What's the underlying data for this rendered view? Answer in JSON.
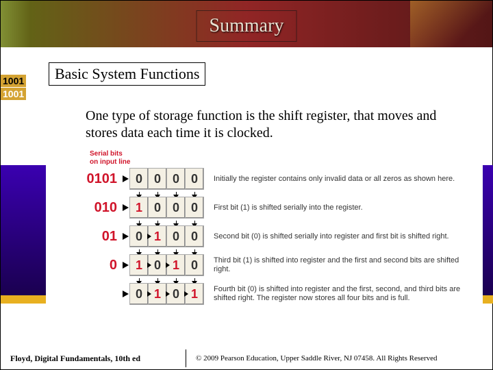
{
  "title": "Summary",
  "subtitle": "Basic System Functions",
  "body": "One type of storage function is the shift register, that moves and stores data each time it is clocked.",
  "serial_label_1": "Serial bits",
  "serial_label_2": "on input line",
  "rows": [
    {
      "input": "0101",
      "cells": [
        "0",
        "0",
        "0",
        "0"
      ],
      "shift_arrows": [],
      "red": [],
      "desc": "Initially the register contains only invalid data or all zeros as shown here."
    },
    {
      "input": "010",
      "cells": [
        "1",
        "0",
        "0",
        "0"
      ],
      "shift_arrows": [],
      "red": [
        0
      ],
      "desc": "First bit (1) is shifted serially into the register."
    },
    {
      "input": "01",
      "cells": [
        "0",
        "1",
        "0",
        "0"
      ],
      "shift_arrows": [
        0
      ],
      "red": [
        1
      ],
      "desc": "Second bit (0) is shifted serially into register and first bit is shifted right."
    },
    {
      "input": "0",
      "cells": [
        "1",
        "0",
        "1",
        "0"
      ],
      "shift_arrows": [
        0,
        1
      ],
      "red": [
        0,
        2
      ],
      "desc": "Third bit (1) is shifted into register and the first and second bits are shifted right."
    },
    {
      "input": "",
      "cells": [
        "0",
        "1",
        "0",
        "1"
      ],
      "shift_arrows": [
        0,
        1,
        2
      ],
      "red": [
        1,
        3
      ],
      "desc": "Fourth bit (0) is shifted into register and the first, second, and third bits are shifted right. The register now stores all four bits and is full."
    }
  ],
  "footer": {
    "left": "Floyd, Digital Fundamentals, 10th ed",
    "right": "© 2009 Pearson Education, Upper Saddle River, NJ 07458. All Rights Reserved"
  }
}
